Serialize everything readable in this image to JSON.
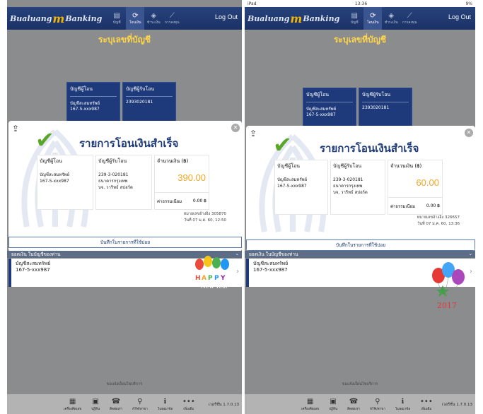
{
  "statusbar": {
    "left": "iPad",
    "time": "13:36",
    "battery": "9%"
  },
  "app": {
    "brand_prefix": "Bualuang",
    "brand_m": "m",
    "brand_suffix": "Banking",
    "logout": "Log Out",
    "nav": [
      {
        "label": "บัญชี",
        "icon": "account-icon"
      },
      {
        "label": "โอนเงิน",
        "icon": "transfer-icon"
      },
      {
        "label": "ชำระเงิน",
        "icon": "payment-icon"
      },
      {
        "label": "การลงทุน",
        "icon": "invest-icon"
      }
    ],
    "page_title": "ระบุเลขที่บัญชี",
    "bg_cards": [
      {
        "label": "บัญชีผู้โอน",
        "value1": "บัญชีสะสมทรัพย์",
        "value2": "167-5-xxx987"
      },
      {
        "label": "บัญชีผู้รับโอน",
        "value1": "2393020181",
        "value2": ""
      }
    ],
    "modal": {
      "title": "รายการโอนเงินสำเร็จ",
      "from_label": "บัญชีผู้โอน",
      "from_type": "บัญชีสะสมทรัพย์",
      "from_no": "167-5-xxx987",
      "to_label": "บัญชีผู้รับโอน",
      "to_no": "239-3-020181",
      "to_bank": "ธนาคารกรุงเทพ",
      "to_name": "บจ. วาริทธ์ สปอร์ต",
      "amount_label": "จำนวนเงิน (฿)",
      "fee_label": "ค่าธรรมเนียม",
      "fee_value": "0.00 ฿",
      "save_button": "บันทึกในรายการที่ใช้บ่อย"
    },
    "balance_title": "ยอดเงิน ในบัญชีของท่าน",
    "balance_account_type": "บัญชีสะสมทรัพย์",
    "balance_account_no": "167-5-xxx987",
    "bottom_note": "ขอแจ้งเงื่อนไขบริการ",
    "tabs": [
      {
        "label": "เครื่องคิดเลข",
        "icon": "calculator-icon"
      },
      {
        "label": "ปฏิทิน",
        "icon": "calendar-icon"
      },
      {
        "label": "ติดต่อเรา",
        "icon": "phone-icon"
      },
      {
        "label": "ATM/สาขา",
        "icon": "map-pin-icon"
      },
      {
        "label": "โฆษณาข้อ",
        "icon": "info-icon"
      },
      {
        "label": "เพิ่มเติม",
        "icon": "more-icon"
      }
    ],
    "version": "เวอร์ชั่น 1.7.0.13"
  },
  "left": {
    "amount": "390.00",
    "ref_label": "หมายเลขอ้างอิง 305870",
    "date_label": "วันที่ 07 ม.ค. 60, 12:50",
    "promo_text": "HAPPY New Year"
  },
  "right": {
    "amount": "60.00",
    "ref_label": "หมายเลขอ้างอิง 326657",
    "date_label": "วันที่ 07 ม.ค. 60, 13:36",
    "promo_text": "2017"
  }
}
